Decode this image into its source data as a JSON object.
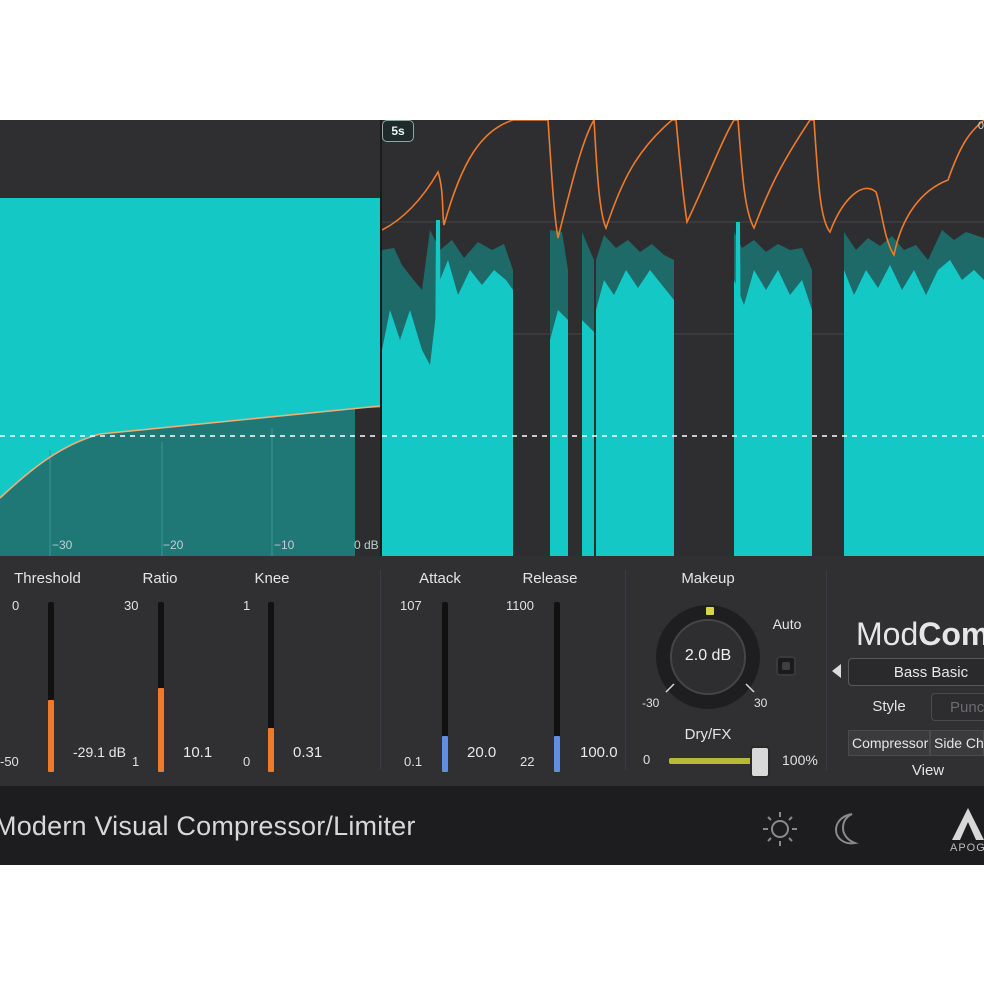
{
  "graph": {
    "ticks": [
      "−30",
      "−20",
      "−10",
      "0 dB"
    ]
  },
  "waveform": {
    "time_window": "5s",
    "top_db": "0"
  },
  "controls": {
    "threshold": {
      "label": "Threshold",
      "max": "0",
      "min": "-50",
      "value": "-29.1 dB",
      "level": 0.58
    },
    "ratio": {
      "label": "Ratio",
      "max": "30",
      "min": "1",
      "value": "10.1",
      "level": 0.44
    },
    "knee": {
      "label": "Knee",
      "max": "1",
      "min": "0",
      "value": "0.31",
      "level": 0.31
    },
    "attack": {
      "label": "Attack",
      "max": "107",
      "min": "0.1",
      "value": "20.0",
      "level": 0.19
    },
    "release": {
      "label": "Release",
      "max": "1100",
      "min": "22",
      "value": "100.0",
      "level": 0.2
    },
    "makeup": {
      "label": "Makeup",
      "value": "2.0 dB",
      "min": "-30",
      "max": "30"
    },
    "auto_label": "Auto",
    "dryfx": {
      "label": "Dry/FX",
      "min": "0",
      "max": "100%",
      "level": 1.0
    },
    "colors": {
      "orange": "#f07a2a",
      "blue": "#5f8fe0",
      "teal": "#13c5c2",
      "olive": "#b8b83a"
    }
  },
  "brand": {
    "prefix": "Mod",
    "bold": "Comp"
  },
  "preset": {
    "value": "Bass Basic"
  },
  "style": {
    "label": "Style",
    "value": "Punch"
  },
  "view": {
    "label": "View",
    "buttons": [
      "Compressor",
      "Side Chain"
    ]
  },
  "footer": {
    "title": "Modern Visual Compressor/Limiter",
    "logo_text": "APOGEE"
  },
  "icons": [
    "sun-icon",
    "moon-icon",
    "apogee-logo-icon",
    "preset-prev-arrow-icon"
  ]
}
